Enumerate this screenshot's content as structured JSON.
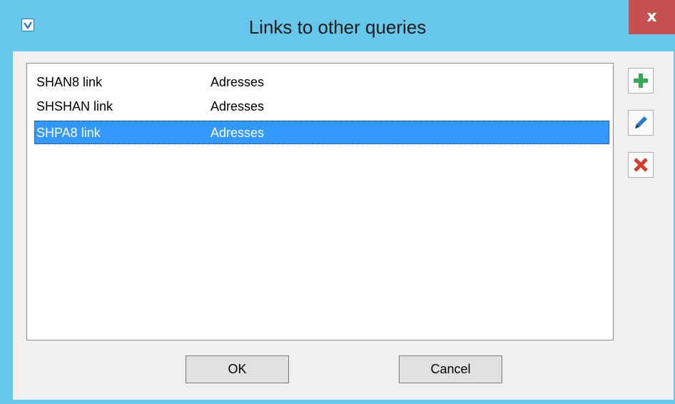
{
  "window": {
    "title": "Links to other queries",
    "close_label": "x"
  },
  "links": [
    {
      "name": "SHAN8 link",
      "target": "Adresses",
      "selected": false
    },
    {
      "name": "SHSHAN link",
      "target": "Adresses",
      "selected": false
    },
    {
      "name": "SHPA8 link",
      "target": "Adresses",
      "selected": true
    }
  ],
  "toolbar": {
    "add_icon": "plus-icon",
    "edit_icon": "pencil-icon",
    "delete_icon": "x-icon"
  },
  "buttons": {
    "ok_label": "OK",
    "cancel_label": "Cancel"
  },
  "colors": {
    "titlebar": "#67c7ea",
    "close": "#c75050",
    "selection": "#3399ff",
    "add": "#3aa757",
    "edit": "#2b79c9",
    "delete": "#d93b2b"
  }
}
